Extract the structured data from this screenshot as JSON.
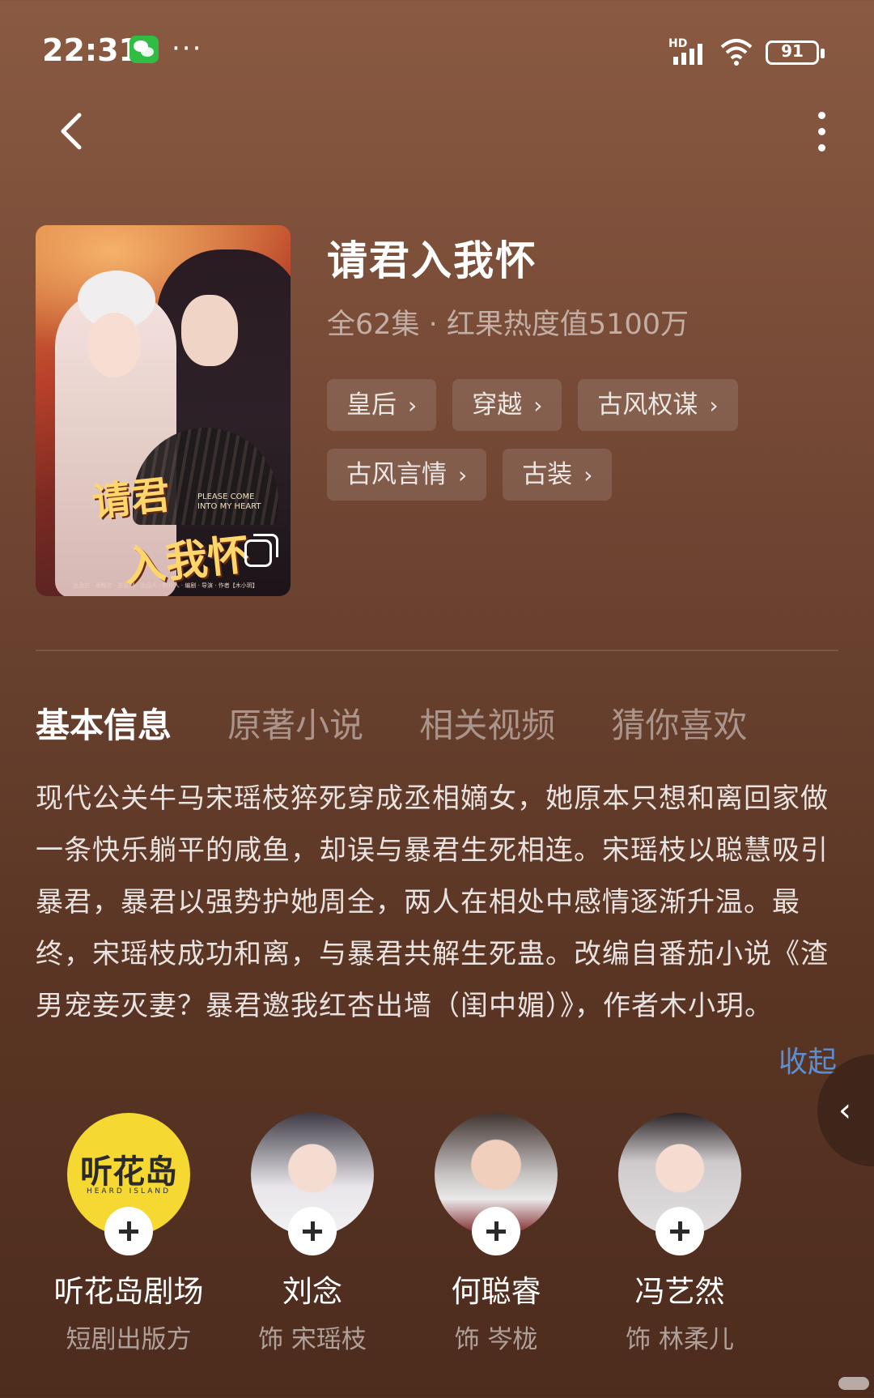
{
  "status_bar": {
    "time": "22:31",
    "hd_label": "HD",
    "battery": "91"
  },
  "header": {
    "back_icon": "chevron-left-icon",
    "menu_icon": "more-vertical-icon"
  },
  "poster": {
    "title_line1": "请君",
    "title_line2": "入我怀",
    "subtitle": "PLEASE COME INTO MY HEART",
    "credits": "出品方 · 承制方 · 总监制 · 出品人 · 制片人 · 编剧 · 导演 · 作者【木小玥】"
  },
  "drama": {
    "title": "请君入我怀",
    "meta": "全62集 · 红果热度值5100万",
    "tags": [
      "皇后",
      "穿越",
      "古风权谋",
      "古风言情",
      "古装"
    ]
  },
  "tabs": [
    "基本信息",
    "原著小说",
    "相关视频",
    "猜你喜欢"
  ],
  "synopsis": "现代公关牛马宋瑶枝猝死穿成丞相嫡女，她原本只想和离回家做一条快乐躺平的咸鱼，却误与暴君生死相连。宋瑶枝以聪慧吸引暴君，暴君以强势护她周全，两人在相处中感情逐渐升温。最终，宋瑶枝成功和离，与暴君共解生死蛊。改编自番茄小说《渣男宠妾灭妻？暴君邀我红杏出墙（闺中媚）》，作者木小玥。",
  "collapse_label": "收起",
  "cast": [
    {
      "name": "听花岛剧场",
      "role": "短剧出版方",
      "brand": "听花岛",
      "brand_sub": "HEARD ISLAND"
    },
    {
      "name": "刘念",
      "role": "饰 宋瑶枝"
    },
    {
      "name": "何聪睿",
      "role": "饰 岑栊"
    },
    {
      "name": "冯艺然",
      "role": "饰 林柔儿"
    }
  ],
  "colors": {
    "background_top": "#8a5a42",
    "background_bottom": "#4d2c1e",
    "link": "#5d8fd0",
    "brand_yellow": "#f6d832"
  }
}
